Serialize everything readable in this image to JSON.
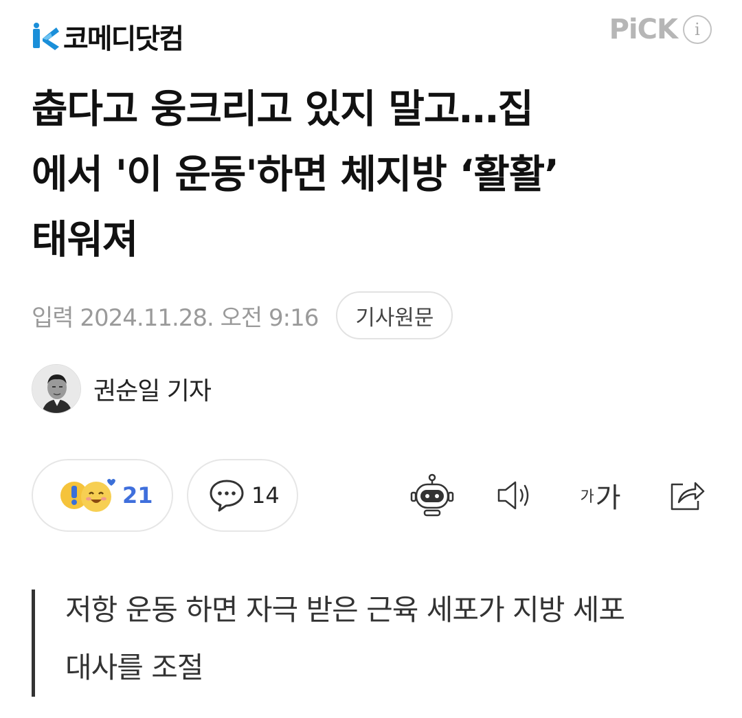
{
  "header": {
    "logo_text": "코메디닷컴",
    "pick_text": "PiCK",
    "info_icon": "i"
  },
  "article": {
    "title_line1": "춥다고 웅크리고 있지 말고…집",
    "title_line2": "에서 '이 운동'하면 체지방 ‘활활’",
    "title_line3": "태워져",
    "date": "입력 2024.11.28. 오전 9:16",
    "original_button": "기사원문",
    "author": "권순일 기자",
    "summary_line1": "저항 운동 하면 자극 받은 근육 세포가 지방 세포",
    "summary_line2": "대사를 조절"
  },
  "actions": {
    "reaction_count": "21",
    "comment_count": "14",
    "font_small": "가",
    "font_big": "가"
  },
  "colors": {
    "brand_blue": "#1a8fd9",
    "reaction_blue": "#3f6fdc",
    "muted_gray": "#9a9a9a"
  }
}
